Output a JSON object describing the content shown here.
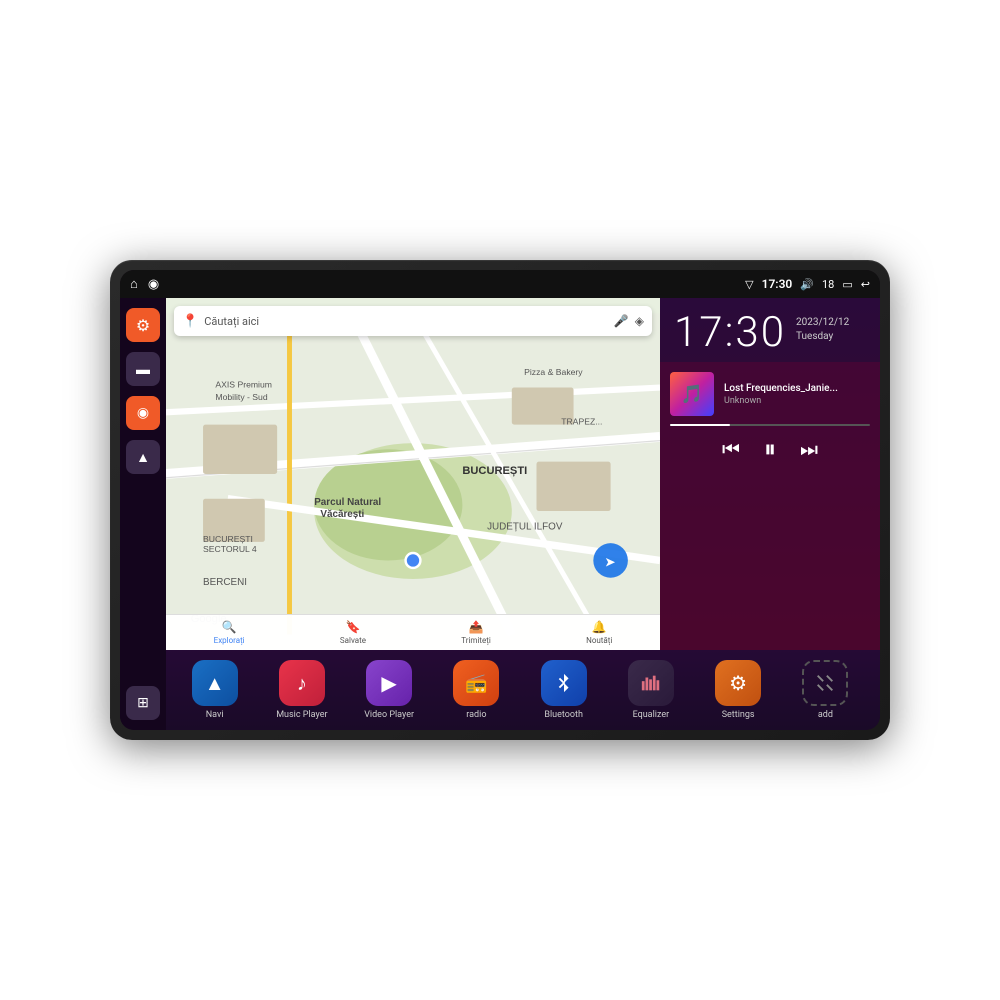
{
  "statusBar": {
    "time": "17:30",
    "batteryLevel": "18",
    "homeIcon": "⌂",
    "mapIcon": "◉",
    "wifiIcon": "▽",
    "volumeIcon": "♪",
    "batteryIcon": "▭",
    "backIcon": "↩"
  },
  "clock": {
    "time": "17:30",
    "date": "2023/12/12",
    "day": "Tuesday"
  },
  "music": {
    "title": "Lost Frequencies_Janie...",
    "artist": "Unknown",
    "thumb": "🎵"
  },
  "map": {
    "searchPlaceholder": "Căutați aici",
    "locations": [
      "AXIS Premium Mobility - Sud",
      "Pizza & Bakery",
      "Parcul Natural Văcărești",
      "BUCUREȘTI",
      "JUDEȚUL ILFOV",
      "BUCUREȘTI SECTORUL 4",
      "BERCENI",
      "TRAPEZULUI"
    ],
    "bottomItems": [
      {
        "icon": "📍",
        "label": "Explorați",
        "active": true
      },
      {
        "icon": "🔖",
        "label": "Salvate",
        "active": false
      },
      {
        "icon": "📤",
        "label": "Trimiteți",
        "active": false
      },
      {
        "icon": "🔔",
        "label": "Noutăți",
        "active": false
      }
    ]
  },
  "sidebar": {
    "items": [
      {
        "icon": "⚙",
        "style": "orange",
        "label": "settings"
      },
      {
        "icon": "📁",
        "style": "dark",
        "label": "files"
      },
      {
        "icon": "📍",
        "style": "orange",
        "label": "maps"
      },
      {
        "icon": "▶",
        "style": "dark",
        "label": "nav"
      }
    ],
    "gridIcon": "⊞"
  },
  "apps": [
    {
      "id": "navi",
      "icon": "▲",
      "label": "Navi",
      "style": "blue-nav"
    },
    {
      "id": "music-player",
      "icon": "♪",
      "label": "Music Player",
      "style": "red-music"
    },
    {
      "id": "video-player",
      "icon": "▶",
      "label": "Video Player",
      "style": "purple-video"
    },
    {
      "id": "radio",
      "icon": "📻",
      "label": "radio",
      "style": "orange-radio"
    },
    {
      "id": "bluetooth",
      "icon": "⚡",
      "label": "Bluetooth",
      "style": "blue-bt"
    },
    {
      "id": "equalizer",
      "icon": "≡",
      "label": "Equalizer",
      "style": "dark-eq"
    },
    {
      "id": "settings",
      "icon": "⚙",
      "label": "Settings",
      "style": "orange-settings"
    },
    {
      "id": "add",
      "icon": "+",
      "label": "add",
      "style": "gray-add"
    }
  ],
  "colors": {
    "accent": "#f05a28",
    "background": "#1a0a1e",
    "sidebar": "#140518"
  }
}
